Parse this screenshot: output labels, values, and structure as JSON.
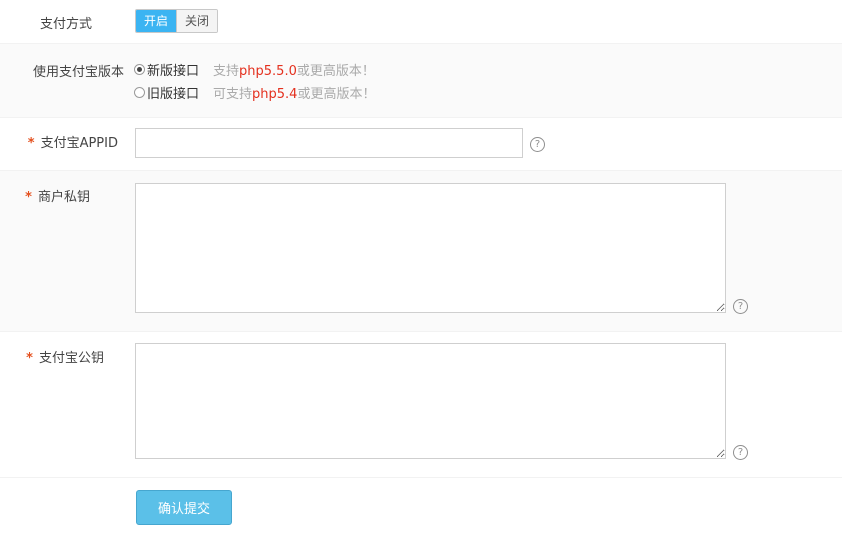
{
  "payment_method": {
    "label": "支付方式",
    "on_label": "开启",
    "off_label": "关闭"
  },
  "alipay_version": {
    "label": "使用支付宝版本",
    "options": [
      {
        "label": "新版接口",
        "hint_prefix": "支持",
        "hint_version": "php5.5.0",
        "hint_suffix": "或更高版本！",
        "checked": true
      },
      {
        "label": "旧版接口",
        "hint_prefix": "可支持",
        "hint_version": "php5.4",
        "hint_suffix": "或更高版本！",
        "checked": false
      }
    ]
  },
  "appid": {
    "required_mark": "*",
    "label": "支付宝APPID",
    "value": "",
    "help_icon": "question-circle-icon"
  },
  "private_key": {
    "required_mark": "*",
    "label": "商户私钥",
    "value": "",
    "help_icon": "question-circle-icon"
  },
  "public_key": {
    "required_mark": "*",
    "label": "支付宝公钥",
    "value": "",
    "help_icon": "question-circle-icon"
  },
  "submit": {
    "label": "确认提交"
  },
  "colors": {
    "accent": "#3bb4f2",
    "button": "#5bc0e8",
    "required": "#e4501e",
    "version_highlight": "#e4301e",
    "hint": "#aaaaaa"
  }
}
